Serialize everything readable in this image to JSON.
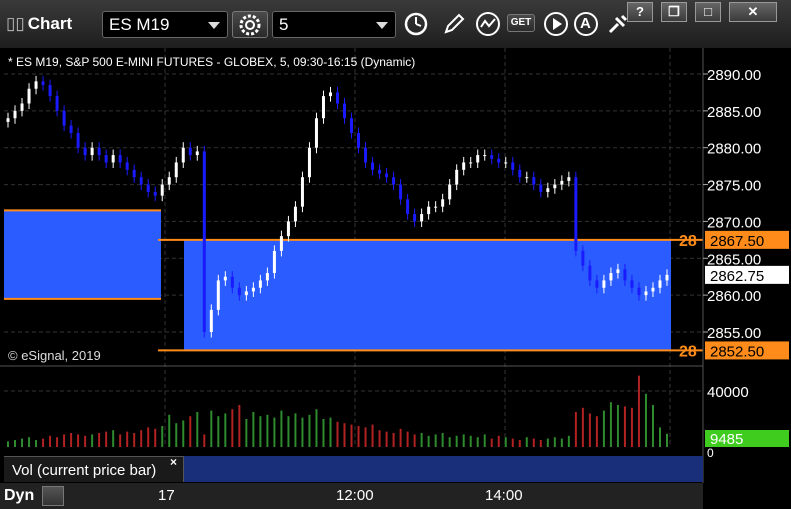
{
  "app": {
    "title": "Chart",
    "symbol": "ES M19",
    "interval": "5",
    "chart_title": "* ES M19, S&P 500 E-MINI FUTURES - GLOBEX, 5, 09:30-16:15 (Dynamic)",
    "copyright": "© eSignal, 2019"
  },
  "toolbar": {
    "settings_icon": "gear-icon",
    "clock_icon": "clock-icon",
    "draw_icon": "pencil-icon",
    "study_icon": "chart-line-icon",
    "get_label": "GET",
    "play_icon": "play-icon",
    "alert_label": "A",
    "tools_icon": "tools-icon"
  },
  "window_buttons": {
    "help": "?",
    "restore": "❐",
    "maximize": "□",
    "close": "✕"
  },
  "price_axis": {
    "ticks": [
      "2890.00",
      "2885.00",
      "2880.00",
      "2875.00",
      "2870.00",
      "2865.00",
      "2860.00",
      "2855.00"
    ],
    "upper_line_tag": "28",
    "upper_line_price": "2867.50",
    "current_price": "2862.75",
    "lower_line_tag": "28",
    "lower_line_price": "2852.50"
  },
  "volume_axis": {
    "tick": "40000",
    "zero": "0",
    "current_volume": "9485"
  },
  "volume_panel": {
    "label": "Vol (current price bar)",
    "close": "×"
  },
  "bottom": {
    "dyn_label": "Dyn",
    "x_labels": [
      "17",
      "12:00",
      "14:00"
    ]
  },
  "colors": {
    "zone": "#2a5cff",
    "zone_line": "#ff8c1a",
    "up_bar": "#ffffff",
    "down_bar": "#1a1aff",
    "volume_up": "#2e8b2e",
    "volume_down": "#b22222",
    "volume_label_bg": "#3fcc1f"
  },
  "chart_data": {
    "type": "candlestick",
    "ylim": [
      2851,
      2893
    ],
    "zones": [
      {
        "from": 2859.5,
        "to": 2871.5
      },
      {
        "from": 2852.5,
        "to": 2867.5
      }
    ],
    "last_price": 2862.75,
    "volume_ylim": [
      0,
      55000
    ],
    "close_prices": [
      2884,
      2885,
      2886,
      2888,
      2889,
      2888.5,
      2887,
      2885,
      2883,
      2882,
      2880,
      2879,
      2880,
      2879,
      2878,
      2879,
      2878,
      2877,
      2876,
      2875,
      2874,
      2873.5,
      2875,
      2876,
      2878,
      2880,
      2879,
      2879.5,
      2855,
      2858,
      2862,
      2862.5,
      2861,
      2860,
      2860.5,
      2861,
      2862,
      2863,
      2866,
      2868,
      2870,
      2872,
      2876,
      2880,
      2884,
      2887,
      2887.5,
      2886,
      2884,
      2882,
      2880,
      2878,
      2877,
      2876.5,
      2876,
      2875,
      2873,
      2871,
      2870,
      2871,
      2872,
      2872,
      2873,
      2875,
      2877,
      2878,
      2878,
      2879,
      2879,
      2878.5,
      2878,
      2878,
      2877,
      2876,
      2876,
      2875,
      2874,
      2874.5,
      2875,
      2875.5,
      2876,
      2866,
      2864,
      2862,
      2861,
      2862,
      2863,
      2863.5,
      2862,
      2861,
      2860,
      2860.5,
      2861,
      2862,
      2862.75
    ],
    "volumes": [
      4000,
      5000,
      6000,
      7000,
      5000,
      6000,
      8000,
      7000,
      9000,
      10000,
      9000,
      8000,
      9000,
      10000,
      11000,
      12000,
      9000,
      11000,
      10000,
      12000,
      14000,
      13000,
      15000,
      23000,
      17000,
      19000,
      22000,
      25000,
      9000,
      26000,
      22000,
      24000,
      27000,
      30000,
      20000,
      25000,
      22000,
      23000,
      21000,
      26000,
      22000,
      24000,
      21000,
      23000,
      27000,
      20000,
      21000,
      18000,
      17000,
      16000,
      15000,
      14000,
      16000,
      12000,
      11000,
      10000,
      13000,
      11000,
      9000,
      10000,
      8000,
      9000,
      10000,
      7000,
      8000,
      9000,
      8000,
      7000,
      9000,
      6000,
      8000,
      7000,
      6000,
      5000,
      7000,
      6000,
      5000,
      6000,
      7000,
      6000,
      8000,
      25000,
      28000,
      24000,
      22000,
      26000,
      32000,
      30000,
      29000,
      28000,
      51000,
      38000,
      30000,
      14000,
      9485
    ]
  }
}
